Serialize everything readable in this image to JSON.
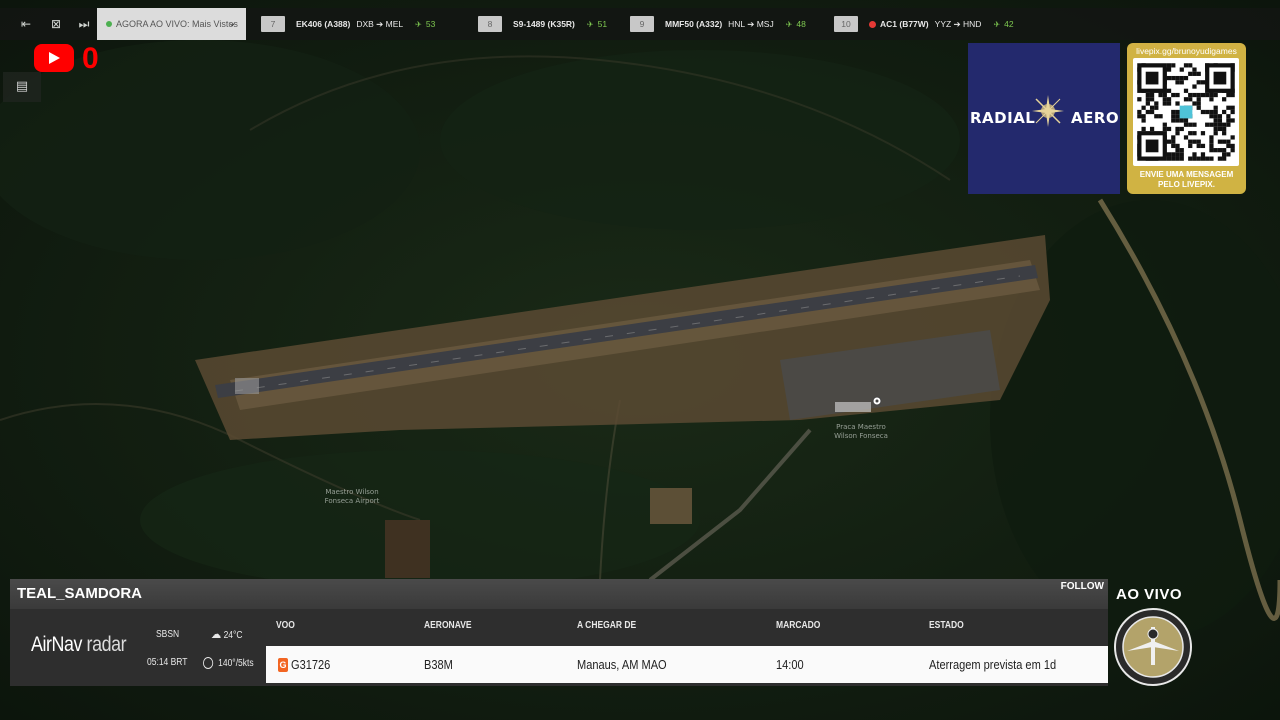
{
  "topbar": {
    "now_live_label": "AGORA AO VIVO: Mais Vistos",
    "flights": [
      {
        "rank": "7",
        "code": "EK406 (A388)",
        "route": "DXB ➔ MEL",
        "count": "53",
        "alert": false
      },
      {
        "rank": "8",
        "code": "S9-1489 (K35R)",
        "route": "",
        "count": "51",
        "alert": false
      },
      {
        "rank": "9",
        "code": "MMF50 (A332)",
        "route": "HNL ➔ MSJ",
        "count": "48",
        "alert": false
      },
      {
        "rank": "10",
        "code": "AC1 (B77W)",
        "route": "YYZ ➔ HND",
        "count": "42",
        "alert": true
      }
    ]
  },
  "youtube": {
    "count": "0"
  },
  "map": {
    "airport_label": "Maestro Wilson\nFonseca Airport",
    "terminal_label": "Praca Maestro\nWilson Fonseca"
  },
  "sponsor": {
    "brand_left": "RADIAL",
    "brand_right": "AERO",
    "url": "livepix.gg/brunoyudigames",
    "message_line1": "ENVIE UMA MENSAGEM",
    "message_line2": "PELO LIVEPIX."
  },
  "airport": {
    "name": "TEAL_SAMDORA",
    "follow_label": "FOLLOW"
  },
  "info": {
    "brand_main": "AirNav",
    "brand_sub": "radar",
    "icao": "SBSN",
    "time": "05:14 BRT",
    "temperature": "24°C",
    "wind": "140°/5kts"
  },
  "table": {
    "headers": {
      "flight": "VOO",
      "aircraft": "AERONAVE",
      "from": "A CHEGAR DE",
      "scheduled": "MARCADO",
      "status": "ESTADO"
    },
    "row": {
      "flight": "G31726",
      "aircraft": "B38M",
      "from": "Manaus, AM MAO",
      "scheduled": "14:00",
      "status": "Aterragem prevista em 1d"
    }
  },
  "live": {
    "label": "AO VIVO"
  },
  "colors": {
    "accent_green": "#7ec850",
    "youtube_red": "#ff0000",
    "sponsor_blue": "#23296d",
    "sponsor_gold": "#d0b343"
  }
}
